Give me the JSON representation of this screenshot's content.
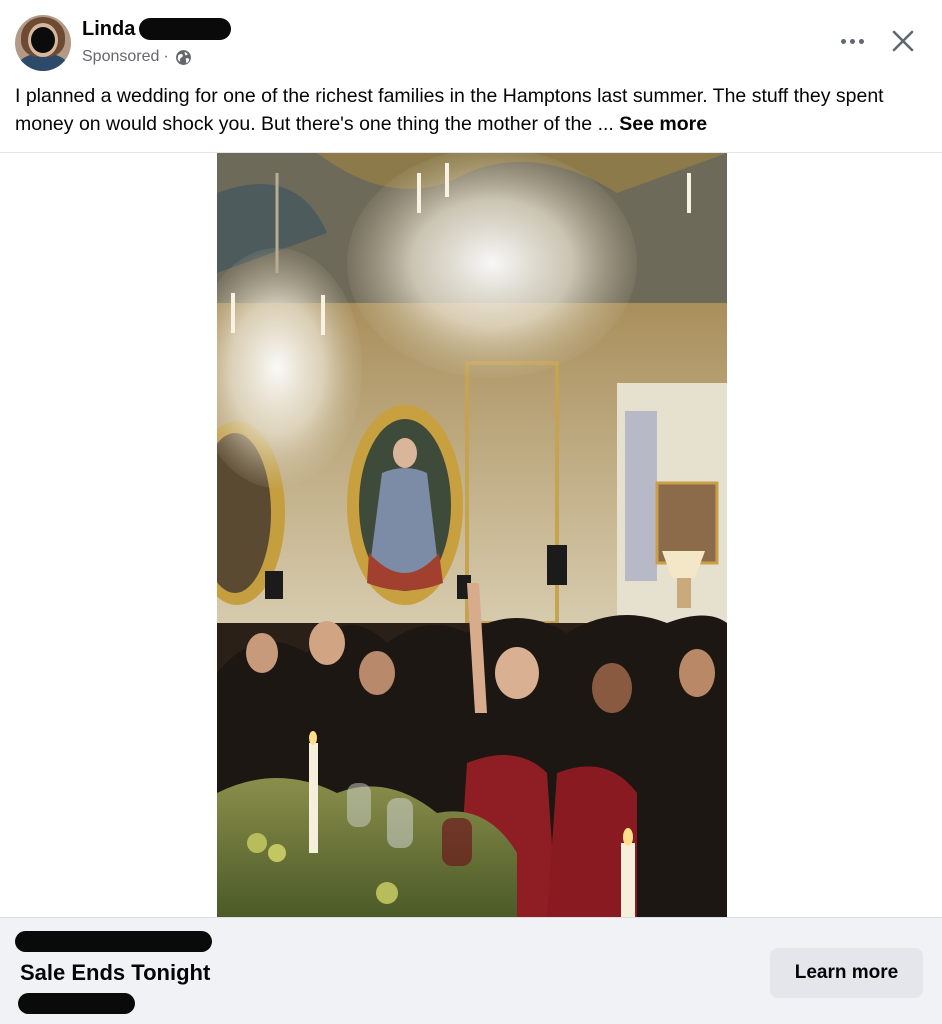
{
  "post": {
    "author_name": "Linda",
    "sponsored_label": "Sponsored",
    "separator": "·",
    "body_text": "I planned a wedding for one of the richest families in the Hamptons last summer. The stuff they spent money on would shock you. But there's one thing the mother of the ... ",
    "see_more_label": "See more"
  },
  "icons": {
    "more": "more-options-icon",
    "close": "close-icon",
    "audience": "globe-icon"
  },
  "ad": {
    "headline": "Sale Ends Tonight",
    "cta_label": "Learn more"
  },
  "colors": {
    "secondary_text": "#65676b",
    "footer_bg": "#f0f2f5",
    "button_bg": "#e4e6eb"
  }
}
